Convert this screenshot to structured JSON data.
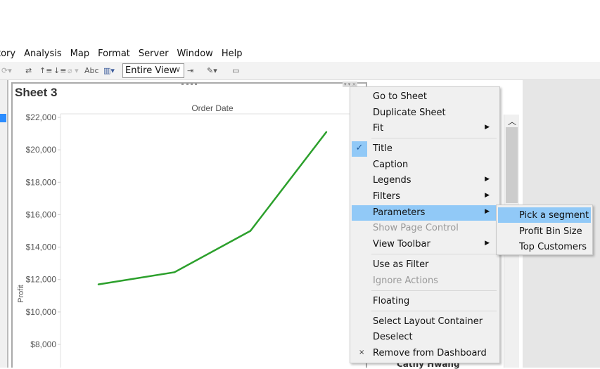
{
  "menubar": [
    "tory",
    "Analysis",
    "Map",
    "Format",
    "Server",
    "Window",
    "Help"
  ],
  "toolbar": {
    "fit_value": "Entire View",
    "abc_label": "Abc"
  },
  "sheet": {
    "title": "Sheet 3"
  },
  "behind_text": "Cathy Hwang",
  "accent_color": "#91c9f7",
  "line_color": "#2ca02c",
  "chart_data": {
    "type": "line",
    "title": "Order Date",
    "ylabel": "Profit",
    "xlabel": "",
    "y_ticks": [
      "$22,000",
      "$20,000",
      "$18,000",
      "$16,000",
      "$14,000",
      "$12,000",
      "$10,000",
      "$8,000"
    ],
    "ylim": [
      8000,
      22000
    ],
    "values": [
      11700,
      12450,
      15000,
      21100
    ],
    "grid": false
  },
  "context_menu": {
    "items": [
      {
        "label": "Go to Sheet"
      },
      {
        "label": "Duplicate Sheet"
      },
      {
        "label": "Fit",
        "submenu": true
      },
      {
        "label": "Title",
        "checked": true
      },
      {
        "label": "Caption"
      },
      {
        "label": "Legends",
        "submenu": true
      },
      {
        "label": "Filters",
        "submenu": true
      },
      {
        "label": "Parameters",
        "submenu": true,
        "highlighted": true
      },
      {
        "label": "Show Page Control",
        "disabled": true
      },
      {
        "label": "View Toolbar",
        "submenu": true
      },
      {
        "label": "Use as Filter"
      },
      {
        "label": "Ignore Actions",
        "disabled": true
      },
      {
        "label": "Floating"
      },
      {
        "label": "Select Layout Container"
      },
      {
        "label": "Deselect"
      },
      {
        "label": "Remove from Dashboard",
        "icon": "x-icon"
      }
    ]
  },
  "parameters_submenu": [
    {
      "label": "Pick a segment",
      "highlighted": true
    },
    {
      "label": "Profit Bin Size"
    },
    {
      "label": "Top Customers"
    }
  ]
}
